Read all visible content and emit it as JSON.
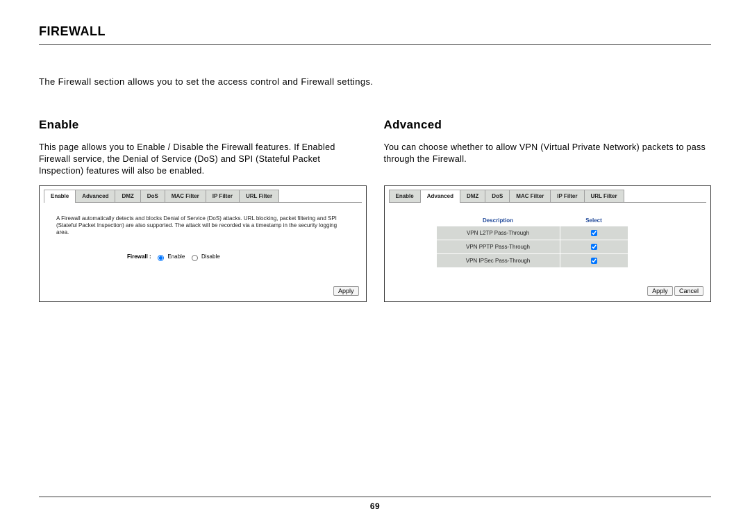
{
  "page": {
    "title": "FIREWALL",
    "intro": "The Firewall section allows you to set the access control and Firewall settings.",
    "number": "69"
  },
  "tabs": {
    "enable": "Enable",
    "advanced": "Advanced",
    "dmz": "DMZ",
    "dos": "DoS",
    "mac": "MAC Filter",
    "ip": "IP Filter",
    "url": "URL Filter"
  },
  "enable": {
    "heading": "Enable",
    "description": "This page allows you to Enable / Disable the Firewall features. If Enabled Firewall service, the Denial of Service (DoS) and SPI (Stateful Packet Inspection) features will also be enabled.",
    "panel_text": "A Firewall automatically detects and blocks Denial of Service (DoS) attacks. URL blocking, packet filtering and SPI (Stateful Packet Inspection) are also supported. The attack will be recorded via a timestamp in the security logging area.",
    "radio_label": "Firewall :",
    "radio_enable": "Enable",
    "radio_disable": "Disable",
    "apply": "Apply"
  },
  "advanced": {
    "heading": "Advanced",
    "description": "You can choose whether to allow VPN (Virtual Private Network) packets to pass through the Firewall.",
    "th_desc": "Description",
    "th_sel": "Select",
    "rows": [
      {
        "desc": "VPN L2TP Pass-Through"
      },
      {
        "desc": "VPN PPTP Pass-Through"
      },
      {
        "desc": "VPN IPSec Pass-Through"
      }
    ],
    "apply": "Apply",
    "cancel": "Cancel"
  }
}
